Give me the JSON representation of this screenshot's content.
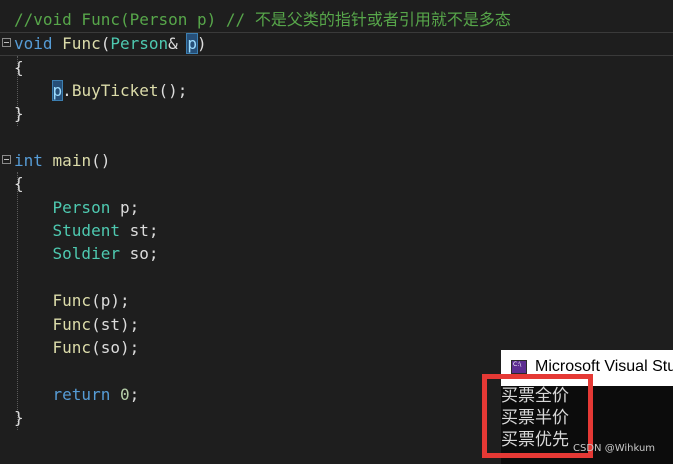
{
  "code": {
    "line1": {
      "comment": "//void Func(Person p) // 不是父类的指针或者引用就不是多态"
    },
    "line2": {
      "kw": "void",
      "fn": "Func",
      "open": "(",
      "type": "Person",
      "amp": "& ",
      "param": "p",
      "close": ")"
    },
    "line3": {
      "brace": "{"
    },
    "line4": {
      "var": "p",
      "rest": ".",
      "method": "BuyTicket",
      "end": "();"
    },
    "line5": {
      "brace": "}"
    },
    "line7": {
      "kw": "int",
      "fn": "main",
      "rest": "()"
    },
    "line8": {
      "brace": "{"
    },
    "line9": {
      "type": "Person",
      "rest": " p;"
    },
    "line10": {
      "type": "Student",
      "rest": " st;"
    },
    "line11": {
      "type": "Soldier",
      "rest": " so;"
    },
    "line13": {
      "fn": "Func",
      "rest": "(p);"
    },
    "line14": {
      "fn": "Func",
      "rest": "(st);"
    },
    "line15": {
      "fn": "Func",
      "rest": "(so);"
    },
    "line17": {
      "kw": "return",
      "num": "0",
      "end": ";"
    },
    "line18": {
      "brace": "}"
    }
  },
  "console": {
    "title": "Microsoft Visual Stu",
    "output": [
      "买票全价",
      "买票半价",
      "买票优先"
    ]
  },
  "watermark": "CSDN @Wihkum",
  "colors": {
    "background": "#1e1e1e",
    "comment": "#57a64a",
    "keyword": "#569cd6",
    "type": "#4ec9b0",
    "function": "#dcdcaa",
    "highlight_outline": "#e53935"
  }
}
